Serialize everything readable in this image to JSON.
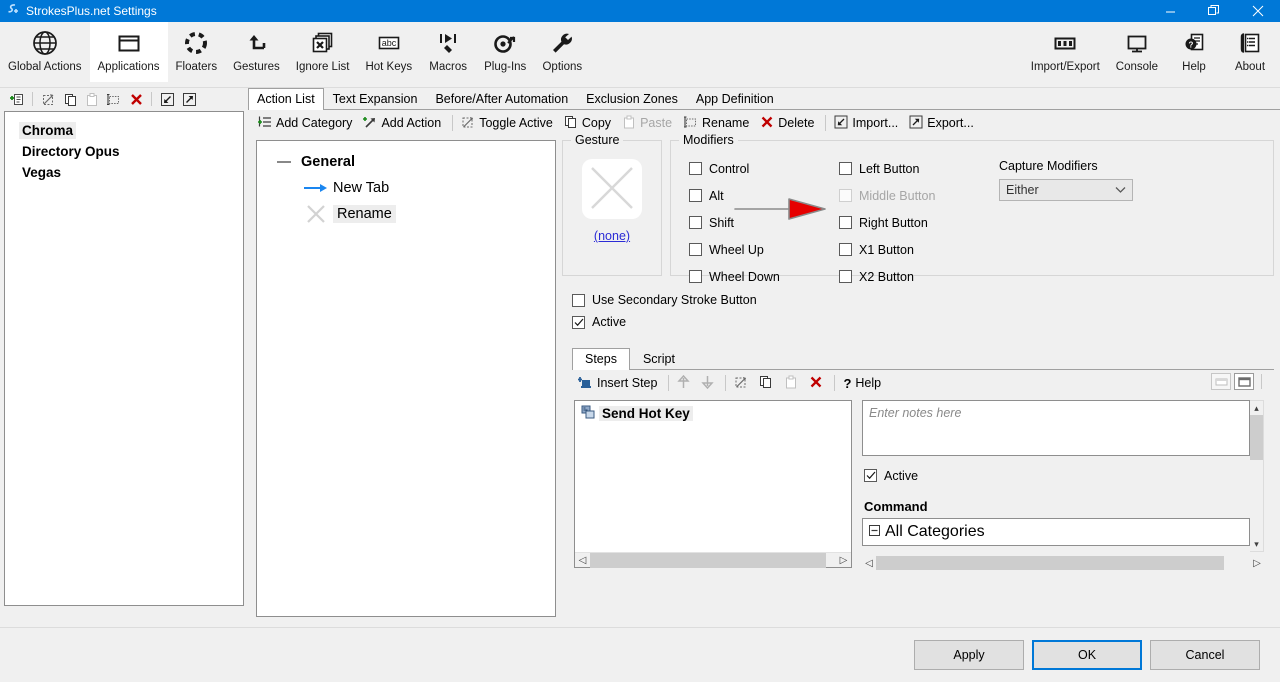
{
  "window": {
    "title": "StrokesPlus.net Settings",
    "app_icon": "strokesplus-icon",
    "minimize": "minimize-icon",
    "restore": "restore-icon",
    "close": "close-icon"
  },
  "ribbon": {
    "items": [
      {
        "label": "Global Actions",
        "icon": "globe-icon",
        "selected": false
      },
      {
        "label": "Applications",
        "icon": "window-icon",
        "selected": true
      },
      {
        "label": "Floaters",
        "icon": "dashed-circle-icon",
        "selected": false
      },
      {
        "label": "Gestures",
        "icon": "arrow-turn-icon",
        "selected": false
      },
      {
        "label": "Ignore List",
        "icon": "stacked-x-icon",
        "selected": false
      },
      {
        "label": "Hot Keys",
        "icon": "abc-icon",
        "selected": false
      },
      {
        "label": "Macros",
        "icon": "macro-play-icon",
        "selected": false
      },
      {
        "label": "Plug-Ins",
        "icon": "plugin-gear-icon",
        "selected": false
      },
      {
        "label": "Options",
        "icon": "wrench-icon",
        "selected": false
      }
    ],
    "right_items": [
      {
        "label": "Import/Export",
        "icon": "import-export-icon"
      },
      {
        "label": "Console",
        "icon": "monitor-icon"
      },
      {
        "label": "Help",
        "icon": "help-doc-icon"
      },
      {
        "label": "About",
        "icon": "about-list-icon"
      }
    ]
  },
  "left_panel": {
    "toolbar": [
      {
        "name": "add-application-icon",
        "label": "Add Application",
        "disabled": false
      },
      {
        "name": "toggle-active-icon",
        "label": "Toggle Active",
        "disabled": false
      },
      {
        "name": "copy-icon",
        "label": "Copy",
        "disabled": false
      },
      {
        "name": "paste-icon",
        "label": "Paste",
        "disabled": true
      },
      {
        "name": "rename-icon",
        "label": "Rename",
        "disabled": false
      },
      {
        "name": "delete-icon",
        "label": "Delete",
        "disabled": false
      },
      {
        "name": "import-icon",
        "label": "Import",
        "disabled": false
      },
      {
        "name": "export-icon",
        "label": "Export",
        "disabled": false
      }
    ],
    "apps": [
      {
        "name": "Chroma",
        "selected": true
      },
      {
        "name": "Directory Opus",
        "selected": false
      },
      {
        "name": "Vegas",
        "selected": false
      }
    ]
  },
  "tabs": [
    {
      "label": "Action List",
      "active": true
    },
    {
      "label": "Text Expansion",
      "active": false
    },
    {
      "label": "Before/After Automation",
      "active": false
    },
    {
      "label": "Exclusion Zones",
      "active": false
    },
    {
      "label": "App Definition",
      "active": false
    }
  ],
  "command_bar": [
    {
      "label": "Add Category",
      "icon": "add-category-icon",
      "disabled": false
    },
    {
      "label": "Add Action",
      "icon": "add-action-icon",
      "disabled": false
    },
    {
      "label": "Toggle Active",
      "icon": "toggle-active-icon",
      "disabled": false
    },
    {
      "label": "Copy",
      "icon": "copy-icon",
      "disabled": false
    },
    {
      "label": "Paste",
      "icon": "paste-icon",
      "disabled": true
    },
    {
      "label": "Rename",
      "icon": "rename-icon",
      "disabled": false
    },
    {
      "label": "Delete",
      "icon": "delete-icon",
      "disabled": false
    },
    {
      "label": "Import...",
      "icon": "import-icon",
      "disabled": false
    },
    {
      "label": "Export...",
      "icon": "export-icon",
      "disabled": false
    }
  ],
  "action_tree": [
    {
      "label": "General",
      "icon": "collapse-dash-icon",
      "type": "category",
      "selected": false
    },
    {
      "label": "New Tab",
      "icon": "gesture-arrow-right-icon",
      "type": "action",
      "selected": false
    },
    {
      "label": "Rename",
      "icon": "gesture-x-icon",
      "type": "action",
      "selected": true
    }
  ],
  "gesture": {
    "legend": "Gesture",
    "preview_icon": "gesture-x-preview",
    "link": "(none)"
  },
  "modifiers": {
    "legend": "Modifiers",
    "left_column": [
      {
        "label": "Control",
        "checked": false,
        "disabled": false
      },
      {
        "label": "Alt",
        "checked": false,
        "disabled": false
      },
      {
        "label": "Shift",
        "checked": false,
        "disabled": false
      },
      {
        "label": "Wheel Up",
        "checked": false,
        "disabled": false
      },
      {
        "label": "Wheel Down",
        "checked": false,
        "disabled": false
      }
    ],
    "right_column": [
      {
        "label": "Left Button",
        "checked": false,
        "disabled": false
      },
      {
        "label": "Middle Button",
        "checked": false,
        "disabled": true
      },
      {
        "label": "Right Button",
        "checked": false,
        "disabled": false
      },
      {
        "label": "X1 Button",
        "checked": false,
        "disabled": false
      },
      {
        "label": "X2 Button",
        "checked": false,
        "disabled": false
      }
    ],
    "capture": {
      "label": "Capture Modifiers",
      "value": "Either",
      "chevron": "chevron-down-icon"
    }
  },
  "options": [
    {
      "label": "Use Secondary Stroke Button",
      "checked": false
    },
    {
      "label": "Active",
      "checked": true
    }
  ],
  "steps": {
    "tabs": [
      {
        "label": "Steps",
        "active": true
      },
      {
        "label": "Script",
        "active": false
      }
    ],
    "toolbar": [
      {
        "label": "Insert Step",
        "icon": "insert-step-icon",
        "disabled": false
      },
      {
        "label": "Move Up",
        "icon": "arrow-up-icon",
        "disabled": true
      },
      {
        "label": "Move Down",
        "icon": "arrow-down-icon",
        "disabled": true
      },
      {
        "label": "Toggle Active",
        "icon": "toggle-active-icon",
        "disabled": false
      },
      {
        "label": "Copy",
        "icon": "copy-icon",
        "disabled": false
      },
      {
        "label": "Paste",
        "icon": "paste-icon",
        "disabled": true
      },
      {
        "label": "Delete",
        "icon": "delete-icon",
        "disabled": false
      },
      {
        "label": "Help",
        "icon": "question-mark-icon",
        "disabled": false
      }
    ],
    "panel_buttons": [
      {
        "name": "restore-panel-button",
        "active": false
      },
      {
        "name": "maximize-panel-button",
        "active": true
      }
    ],
    "list": [
      {
        "label": "Send Hot Key",
        "icon": "send-hot-key-icon",
        "selected": true
      }
    ]
  },
  "step_detail": {
    "notes_placeholder": "Enter notes here",
    "notes_value": "",
    "active": {
      "label": "Active",
      "checked": true
    },
    "command_label": "Command",
    "command_tree": [
      {
        "label": "All Categories",
        "icon": "collapse-box-icon"
      }
    ]
  },
  "dialog_buttons": [
    {
      "label": "Apply",
      "default": false
    },
    {
      "label": "OK",
      "default": true
    },
    {
      "label": "Cancel",
      "default": false
    }
  ],
  "annotation": {
    "name": "red-arrow-pointer",
    "color": "#e60000"
  },
  "colors": {
    "titlebar": "#0078d7",
    "accent": "#0078d7",
    "delete_red": "#c00000",
    "link_blue": "#2b2bd6",
    "arrow_red": "#e60000"
  }
}
